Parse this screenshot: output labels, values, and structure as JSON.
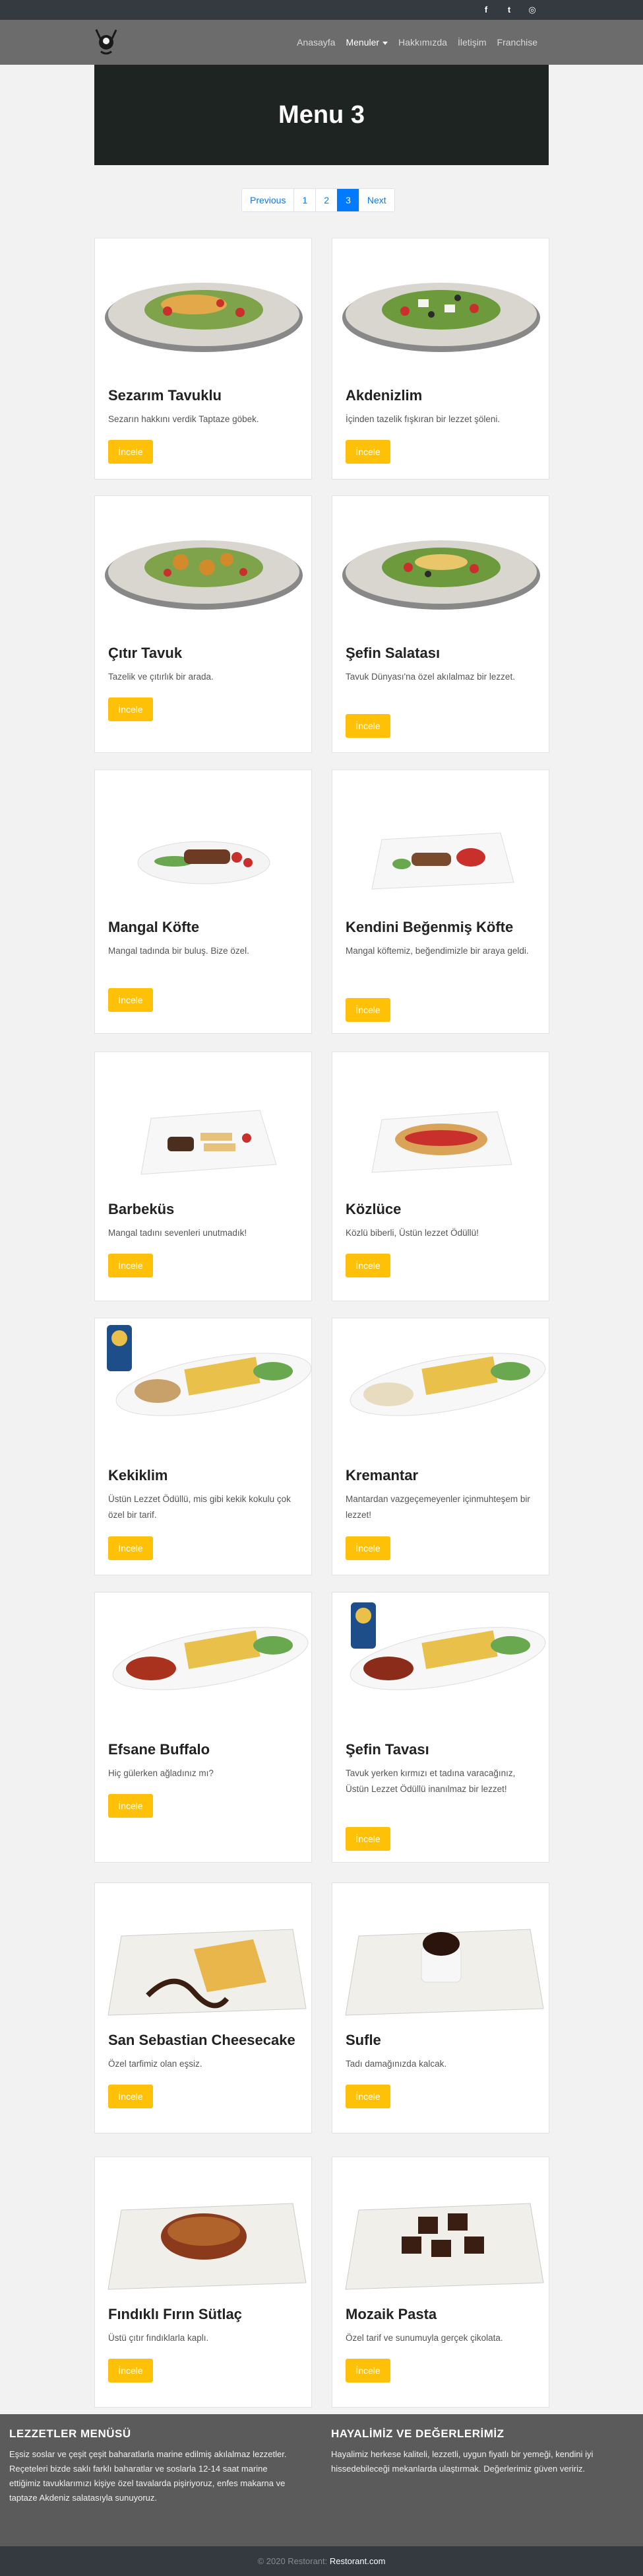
{
  "social": {
    "facebook": "f",
    "twitter": "t",
    "instagram": "◎"
  },
  "nav": {
    "items": [
      "Anasayfa",
      "Menuler",
      "Hakkımızda",
      "İletişim",
      "Franchise"
    ]
  },
  "hero": {
    "title": "Menu 3"
  },
  "pagination": {
    "prev": "Previous",
    "p1": "1",
    "p2": "2",
    "p3": "3",
    "next": "Next"
  },
  "menu": {
    "button_label": "İncele",
    "items": [
      {
        "title": "Sezarım Tavuklu",
        "desc": "Sezarın hakkını verdik Taptaze göbek."
      },
      {
        "title": "Akdenizlim",
        "desc": "İçinden tazelik fışkıran bir lezzet şöleni."
      },
      {
        "title": "Çıtır Tavuk",
        "desc": "Tazelik ve çıtırlık bir arada."
      },
      {
        "title": "Şefin Salatası",
        "desc": "Tavuk Dünyası'na özel akılalmaz bir lezzet."
      },
      {
        "title": "Mangal Köfte",
        "desc": "Mangal tadında bir buluş. Bize özel."
      },
      {
        "title": "Kendini Beğenmiş Köfte",
        "desc": "Mangal köftemiz, beğendimizle bir araya geldi."
      },
      {
        "title": "Barbeküs",
        "desc": "Mangal tadını sevenleri unutmadık!"
      },
      {
        "title": "Közlüce",
        "desc": "Közlü biberli, Üstün lezzet Ödüllü!"
      },
      {
        "title": "Kekiklim",
        "desc": "Üstün Lezzet Ödüllü, mis gibi kekik kokulu çok özel bir tarif."
      },
      {
        "title": "Kremantar",
        "desc": "Mantardan vazgeçemeyenler içinmuhteşem bir lezzet!"
      },
      {
        "title": "Efsane Buffalo",
        "desc": "Hiç gülerken ağladınız mı?"
      },
      {
        "title": "Şefin Tavası",
        "desc": "Tavuk yerken kırmızı et tadına varacağınız, Üstün Lezzet Ödüllü inanılmaz bir lezzet!"
      },
      {
        "title": "San Sebastian Cheesecake",
        "desc": "Özel tarfimiz olan eşsiz."
      },
      {
        "title": "Sufle",
        "desc": "Tadı damağınızda kalcak."
      },
      {
        "title": "Fındıklı Fırın Sütlaç",
        "desc": "Üstü çıtır fındıklarla kaplı."
      },
      {
        "title": "Mozaik Pasta",
        "desc": "Özel tarif ve sunumuyla gerçek çikolata."
      }
    ]
  },
  "footer": {
    "left_title": "LEZZETLER MENÜSÜ",
    "left_text": "Eşsiz soslar ve çeşit çeşit baharatlarla marine edilmiş akılalmaz lezzetler. Reçeteleri bizde saklı farklı baharatlar ve soslarla 12-14 saat marine ettiğimiz tavuklarımızı kişiye özel tavalarda pişiriyoruz, enfes makarna ve taptaze Akdeniz salatasıyla sunuyoruz.",
    "right_title": "HAYALİMİZ VE DEĞERLERİMİZ",
    "right_text": "Hayalimiz herkese kaliteli, lezzetli, uygun fiyatlı bir yemeği, kendini iyi hissedebileceği mekanlarda ulaştırmak. Değerlerimiz güven veririz.",
    "copyright": "© 2020 Restorant:",
    "brand": "Restorant.com"
  }
}
